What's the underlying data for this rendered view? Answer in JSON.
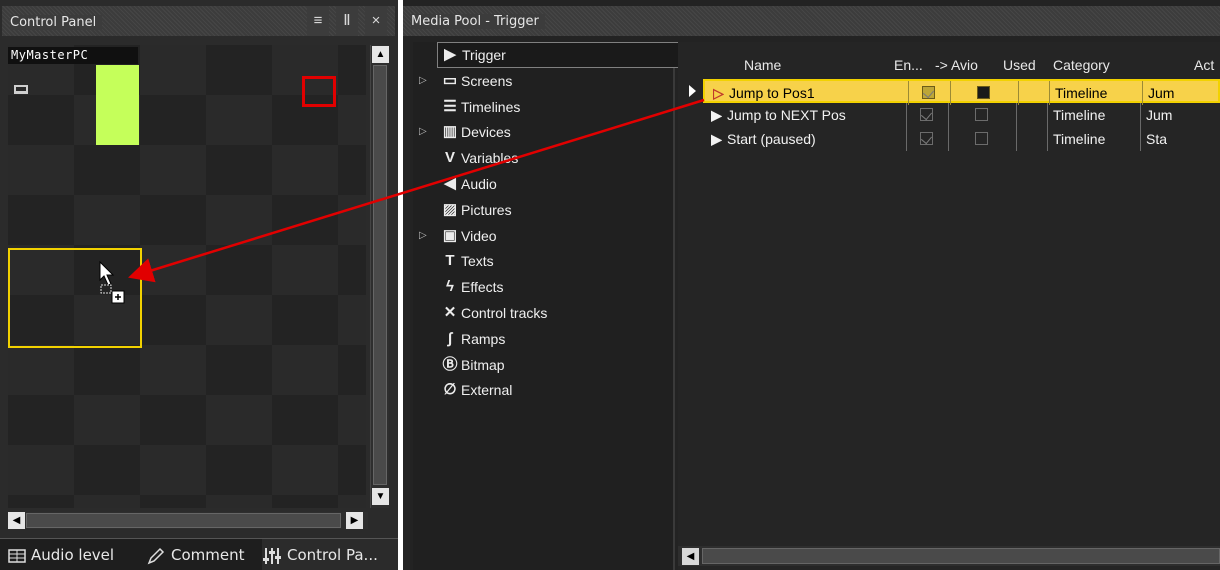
{
  "control_panel": {
    "title": "Control Panel",
    "buttons": [
      "≡",
      "Ⅱ",
      "×"
    ],
    "pc_name": "MyMasterPC",
    "tabs": [
      {
        "label": "Audio level",
        "icon": "audio-level-icon"
      },
      {
        "label": "Comment",
        "icon": "pencil-icon"
      },
      {
        "label": "Control Pa...",
        "icon": "sliders-icon"
      }
    ]
  },
  "media_pool": {
    "title": "Media Pool - Trigger",
    "tree": [
      {
        "label": "Trigger",
        "icon": "trigger-icon",
        "selected": true,
        "expandable": false
      },
      {
        "label": "Screens",
        "icon": "screens-icon",
        "expandable": true
      },
      {
        "label": "Timelines",
        "icon": "timelines-icon",
        "expandable": false
      },
      {
        "label": "Devices",
        "icon": "devices-icon",
        "expandable": true
      },
      {
        "label": "Variables",
        "icon": "variables-icon",
        "expandable": false
      },
      {
        "label": "Audio",
        "icon": "audio-icon",
        "expandable": false
      },
      {
        "label": "Pictures",
        "icon": "pictures-icon",
        "expandable": false
      },
      {
        "label": "Video",
        "icon": "video-icon",
        "expandable": true
      },
      {
        "label": "Texts",
        "icon": "texts-icon",
        "expandable": false
      },
      {
        "label": "Effects",
        "icon": "effects-icon",
        "expandable": false
      },
      {
        "label": "Control tracks",
        "icon": "control-tracks-icon",
        "expandable": false
      },
      {
        "label": "Ramps",
        "icon": "ramps-icon",
        "expandable": false
      },
      {
        "label": "Bitmap",
        "icon": "bitmap-icon",
        "expandable": false
      },
      {
        "label": "External",
        "icon": "paperclip-icon",
        "expandable": false
      }
    ],
    "columns": [
      "Name",
      "En...",
      "-> Avio",
      "Used",
      "Category",
      "Act"
    ],
    "rows": [
      {
        "name": "Jump to Pos1",
        "enabled": true,
        "avio": true,
        "used": "",
        "category": "Timeline",
        "action": "Jum",
        "selected": true
      },
      {
        "name": "Jump to NEXT Pos",
        "enabled": true,
        "avio": false,
        "used": "",
        "category": "Timeline",
        "action": "Jum",
        "selected": false
      },
      {
        "name": "Start  (paused)",
        "enabled": true,
        "avio": false,
        "used": "",
        "category": "Timeline",
        "action": "Sta",
        "selected": false
      }
    ]
  },
  "colors": {
    "selection_yellow": "#f7d24a",
    "cell_highlight": "#f2d200",
    "green_cell": "#c5ff5a",
    "arrow_red": "#e10000"
  }
}
